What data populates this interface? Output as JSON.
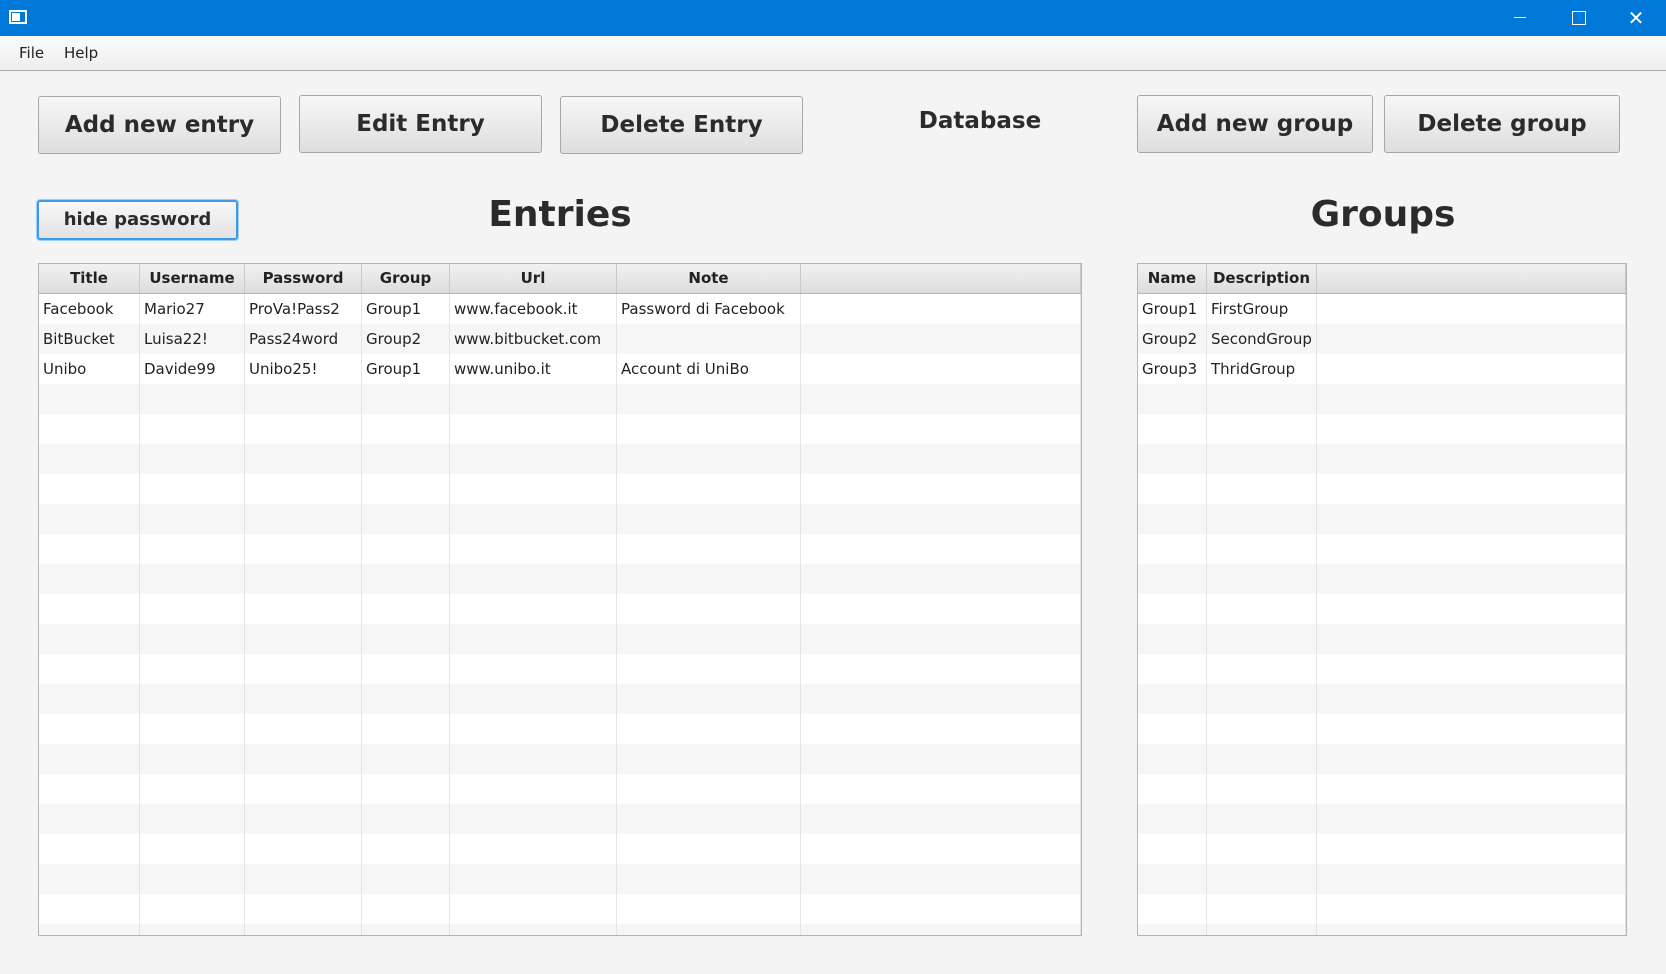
{
  "window": {
    "controls": {
      "minimize": "–",
      "maximize": "□",
      "close": "✕"
    }
  },
  "menu": {
    "items": [
      "File",
      "Help"
    ]
  },
  "toolbar": {
    "add_entry": "Add new entry",
    "edit_entry": "Edit Entry",
    "delete_entry": "Delete Entry",
    "database_label": "Database",
    "add_group": "Add new group",
    "delete_group": "Delete group"
  },
  "hide_password_label": "hide password",
  "entries": {
    "title": "Entries",
    "columns": [
      "Title",
      "Username",
      "Password",
      "Group",
      "Url",
      "Note",
      ""
    ],
    "rows": [
      [
        "Facebook",
        "Mario27",
        "ProVa!Pass2",
        "Group1",
        "www.facebook.it",
        "Password di Facebook",
        ""
      ],
      [
        "BitBucket",
        "Luisa22!",
        "Pass24word",
        "Group2",
        "www.bitbucket.com",
        "",
        ""
      ],
      [
        "Unibo",
        "Davide99",
        "Unibo25!",
        "Group1",
        "www.unibo.it",
        "Account di UniBo",
        ""
      ]
    ]
  },
  "groups": {
    "title": "Groups",
    "columns": [
      "Name",
      "Description",
      ""
    ],
    "rows": [
      [
        "Group1",
        "FirstGroup",
        ""
      ],
      [
        "Group2",
        "SecondGroup",
        ""
      ],
      [
        "Group3",
        "ThridGroup",
        ""
      ]
    ]
  }
}
